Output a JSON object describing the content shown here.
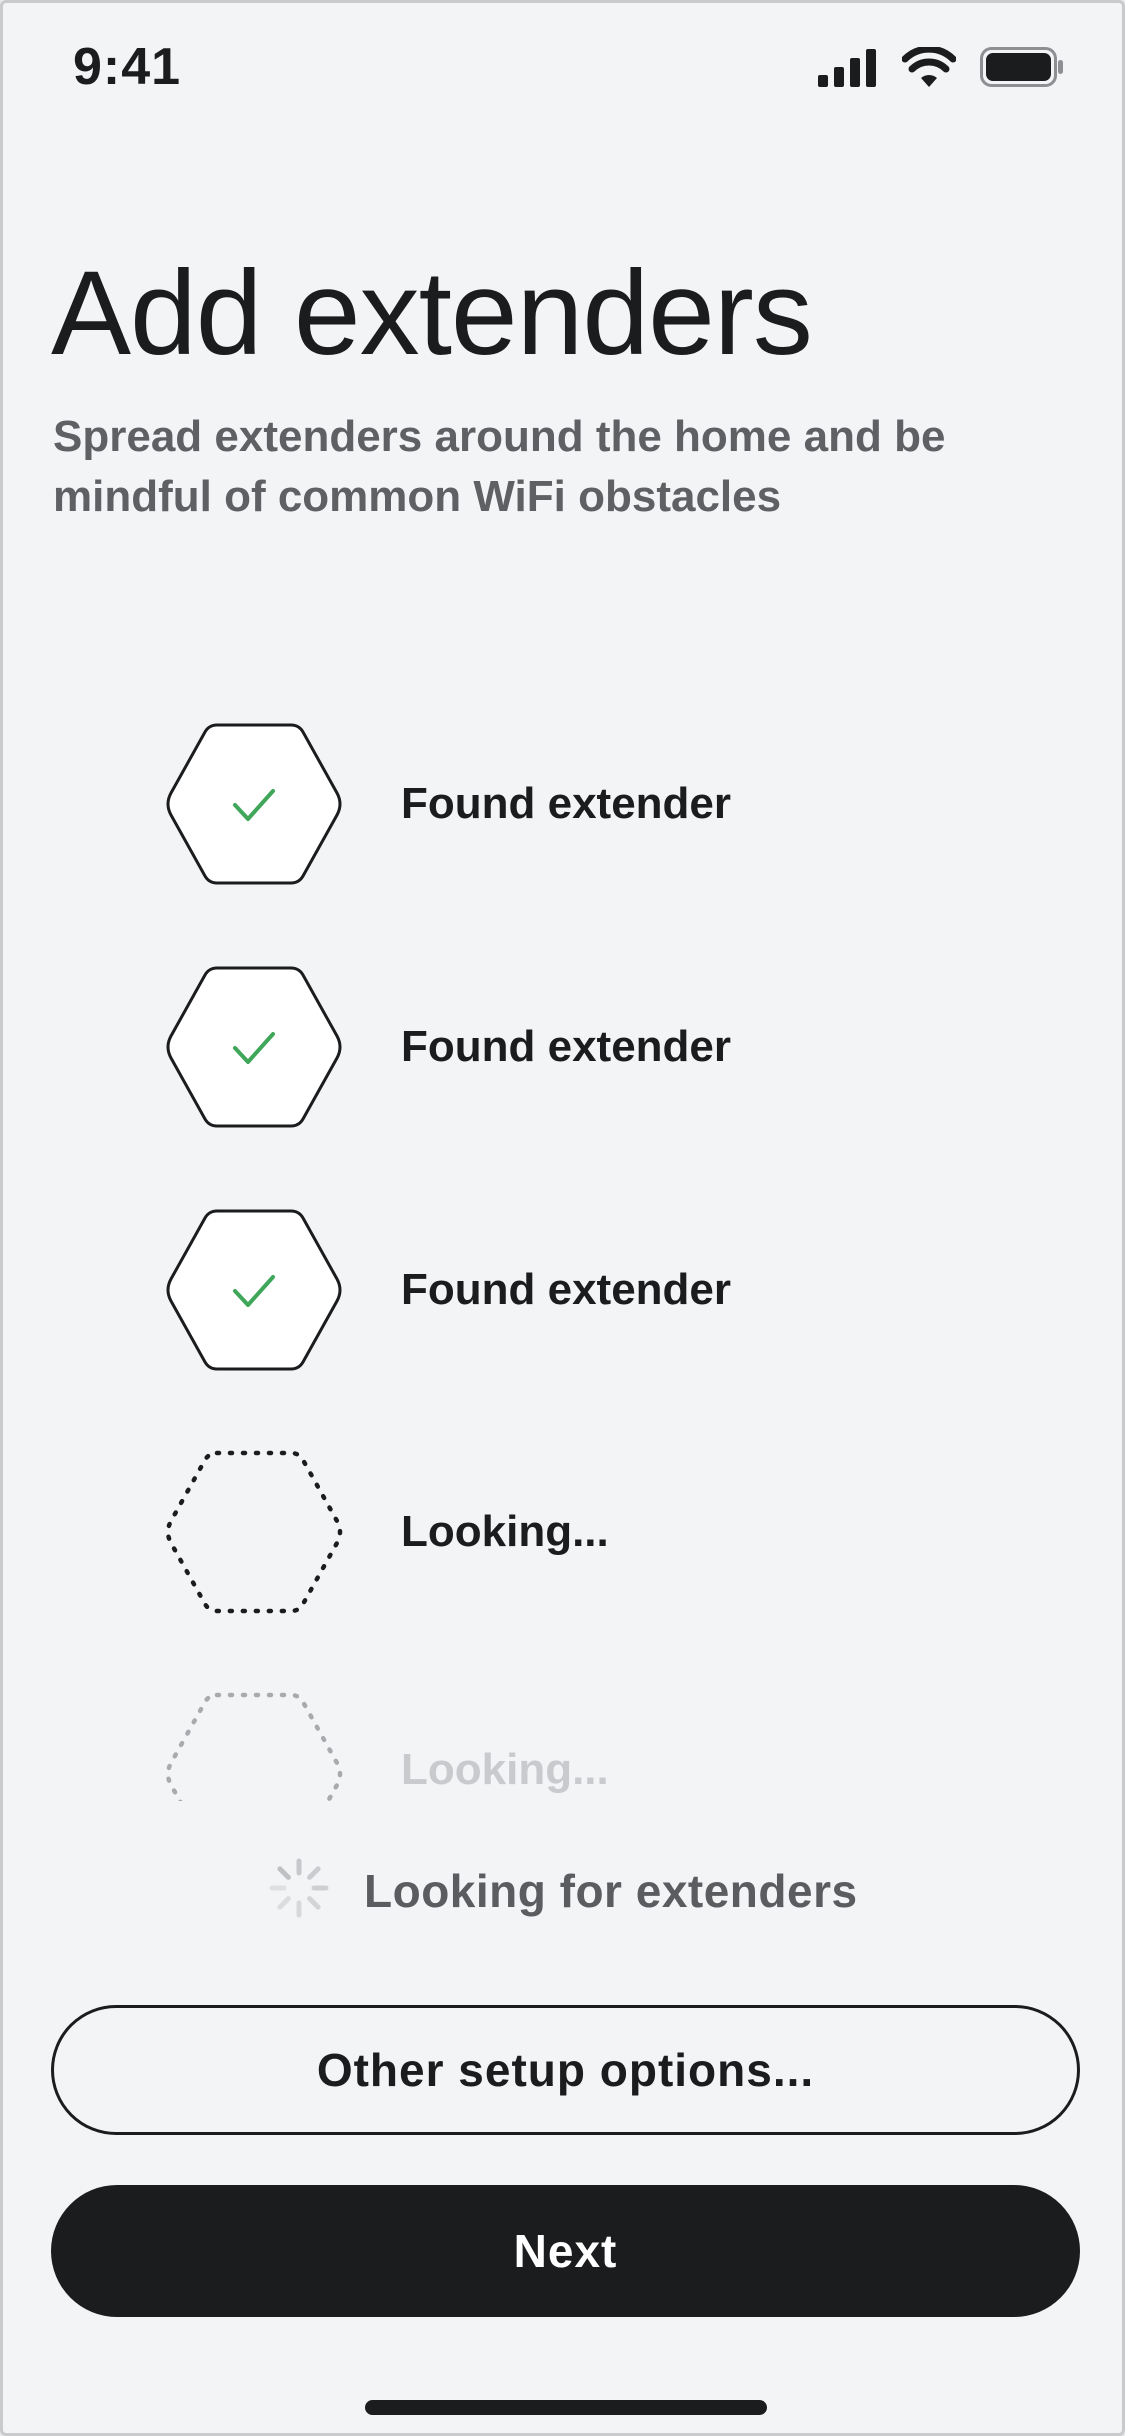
{
  "status_bar": {
    "time": "9:41",
    "icons": [
      "cellular-signal-icon",
      "wifi-icon",
      "battery-icon"
    ]
  },
  "header": {
    "title": "Add extenders",
    "subtitle": "Spread extenders around the home and be mindful of common WiFi obstacles"
  },
  "extenders": [
    {
      "state": "found",
      "label": "Found extender",
      "icon": "checkmark-icon"
    },
    {
      "state": "found",
      "label": "Found extender",
      "icon": "checkmark-icon"
    },
    {
      "state": "found",
      "label": "Found extender",
      "icon": "checkmark-icon"
    },
    {
      "state": "looking",
      "label": "Looking..."
    },
    {
      "state": "looking-faded",
      "label": "Looking..."
    }
  ],
  "searching": {
    "label": "Looking for extenders",
    "icon": "spinner-icon"
  },
  "buttons": {
    "other_options": "Other setup options...",
    "next": "Next"
  },
  "colors": {
    "background": "#f3f4f6",
    "text_primary": "#1b1c1e",
    "text_secondary": "#5f6064",
    "check_green": "#3fa65a",
    "primary_button": "#1b1c1e"
  }
}
